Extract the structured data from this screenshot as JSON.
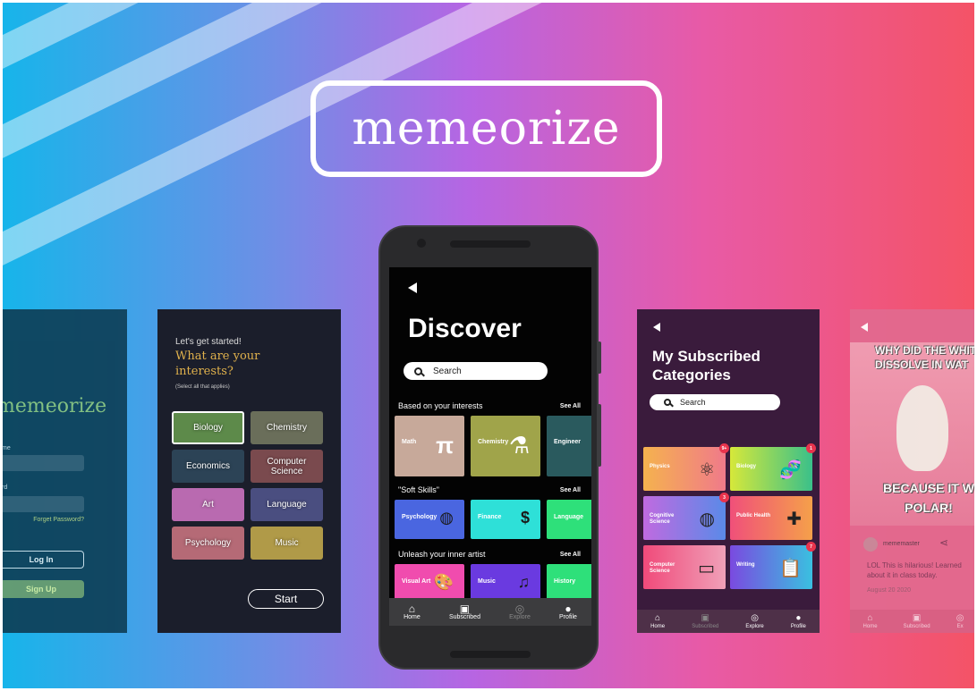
{
  "brand": {
    "logo_text": "memeorize"
  },
  "login_screen": {
    "app_name": "memeorize",
    "username_label": "me",
    "password_label": "rd",
    "forgot_password": "Forget Password?",
    "login_button": "Log In",
    "signup_button": "Sign Up"
  },
  "interests_screen": {
    "intro": "Let's get started!",
    "question": "What are your interests?",
    "hint": "(Select all that applies)",
    "topics": [
      {
        "label": "Biology",
        "color": "#5d8a4a",
        "selected": true
      },
      {
        "label": "Chemistry",
        "color": "#6a6e5a",
        "selected": false
      },
      {
        "label": "Economics",
        "color": "#2c4356",
        "selected": false
      },
      {
        "label": "Computer Science",
        "color": "#7a4a4e",
        "selected": false
      },
      {
        "label": "Art",
        "color": "#b96ab0",
        "selected": false
      },
      {
        "label": "Language",
        "color": "#4a4e80",
        "selected": false
      },
      {
        "label": "Psychology",
        "color": "#b56a76",
        "selected": false
      },
      {
        "label": "Music",
        "color": "#b09a48",
        "selected": false
      }
    ],
    "start_button": "Start"
  },
  "discover_screen": {
    "title": "Discover",
    "search_placeholder": "Search",
    "sections": [
      {
        "title": "Based on your interests",
        "see_all": "See All",
        "cards": [
          {
            "label": "Math",
            "icon": "π",
            "color": "#c7a99a"
          },
          {
            "label": "Chemistry",
            "icon": "⚗",
            "color": "#a0a44a"
          },
          {
            "label": "Engineer",
            "icon": "",
            "color": "#2a5a5e"
          }
        ]
      },
      {
        "title": "\"Soft Skills\"",
        "see_all": "See All",
        "cards": [
          {
            "label": "Psychology",
            "icon": "◍",
            "color": "#4a66e0"
          },
          {
            "label": "Finance",
            "icon": "$",
            "color": "#2ee0d8"
          },
          {
            "label": "Language",
            "icon": "",
            "color": "#2ee07a"
          }
        ]
      },
      {
        "title": "Unleash your inner artist",
        "see_all": "See All",
        "cards": [
          {
            "label": "Visual Art",
            "icon": "🎨",
            "color": "#f04cae"
          },
          {
            "label": "Music",
            "icon": "♫",
            "color": "#6a3ae0"
          },
          {
            "label": "History",
            "icon": "",
            "color": "#2ee07a"
          }
        ]
      }
    ],
    "nav": [
      {
        "label": "Home",
        "icon": "home-icon",
        "active": true
      },
      {
        "label": "Subscribed",
        "icon": "bookmark-icon",
        "active": true
      },
      {
        "label": "Explore",
        "icon": "globe-icon",
        "active": false
      },
      {
        "label": "Profile",
        "icon": "person-icon",
        "active": true
      }
    ]
  },
  "subscribed_screen": {
    "title": "My Subscribed Categories",
    "search_placeholder": "Search",
    "categories": [
      {
        "label": "Physics",
        "icon": "⚛",
        "badge": "9+",
        "color_a": "#f5b24e",
        "color_b": "#f07a8a"
      },
      {
        "label": "Biology",
        "icon": "🧬",
        "badge": "1",
        "color_a": "#d6e83a",
        "color_b": "#3ac08a"
      },
      {
        "label": "Cognitive Science",
        "icon": "◍",
        "badge": "3",
        "color_a": "#c06ae0",
        "color_b": "#5a8ae8"
      },
      {
        "label": "Public Health",
        "icon": "✚",
        "badge": "",
        "color_a": "#f0507a",
        "color_b": "#f5a04a"
      },
      {
        "label": "Computer Science",
        "icon": "▭",
        "badge": "",
        "color_a": "#f04a7a",
        "color_b": "#f0a0b8"
      },
      {
        "label": "Writing",
        "icon": "📋",
        "badge": "7",
        "color_a": "#7a4ae0",
        "color_b": "#3ac0e0"
      }
    ],
    "nav": [
      {
        "label": "Home"
      },
      {
        "label": "Subscribed"
      },
      {
        "label": "Explore"
      },
      {
        "label": "Profile"
      }
    ]
  },
  "meme_screen": {
    "top_text": "WHY DID THE WHIT DISSOLVE IN WAT",
    "bottom_text": "BECAUSE IT W POLAR!",
    "author": "mememaster",
    "comment": "LOL This is hilarious! Learned about it in class today.",
    "date": "August 20 2020",
    "nav": [
      {
        "label": "Home"
      },
      {
        "label": "Subscribed"
      },
      {
        "label": "Ex"
      }
    ]
  }
}
